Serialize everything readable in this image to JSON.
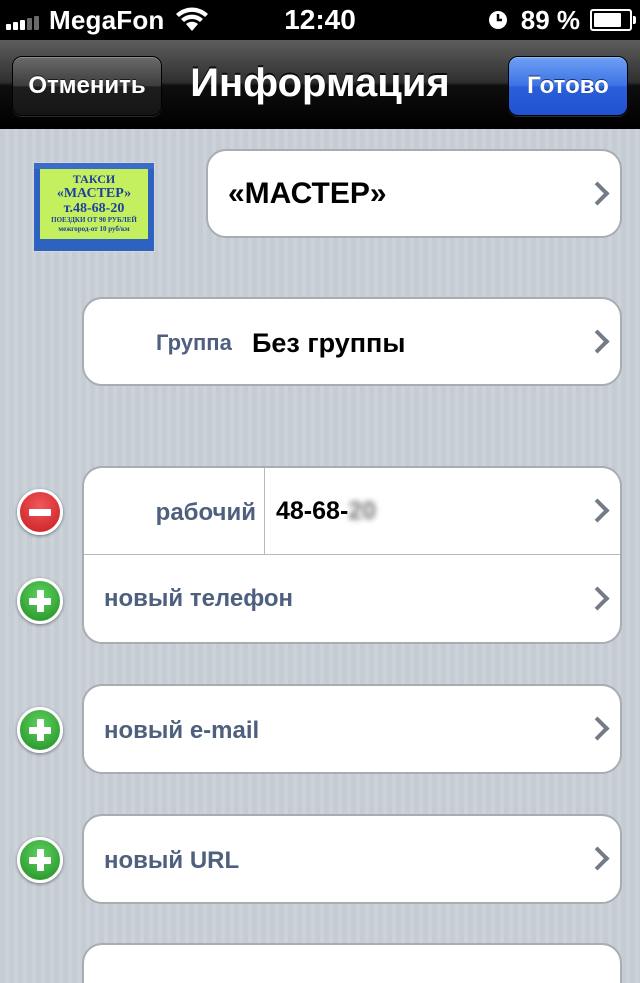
{
  "status_bar": {
    "carrier": "MegaFon",
    "time": "12:40",
    "battery_percent": "89 %",
    "battery_level": 0.89,
    "icons": [
      "signal-icon",
      "wifi-icon",
      "alarm-icon",
      "battery-icon"
    ]
  },
  "nav": {
    "cancel_label": "Отменить",
    "title": "Информация",
    "done_label": "Готово"
  },
  "contact": {
    "photo_text": [
      "ТАКСИ",
      "«МАСТЕР»",
      "т.48-68-20",
      "ПОЕЗДКИ ОТ 90 РУБЛЕЙ",
      "межгород-от 10 руб/км"
    ],
    "name": "«МАСТЕР»"
  },
  "group": {
    "label": "Группа",
    "value": "Без группы"
  },
  "phones": [
    {
      "label": "рабочий",
      "value": "48-68-",
      "blurred": "20"
    }
  ],
  "add_phone_label": "новый телефон",
  "add_email_label": "новый e-mail",
  "add_url_label": "новый URL",
  "colors": {
    "label_blue": "#4e607e",
    "done_button": "#2a5fdc",
    "remove": "#c81c21",
    "add": "#1f8e23"
  }
}
